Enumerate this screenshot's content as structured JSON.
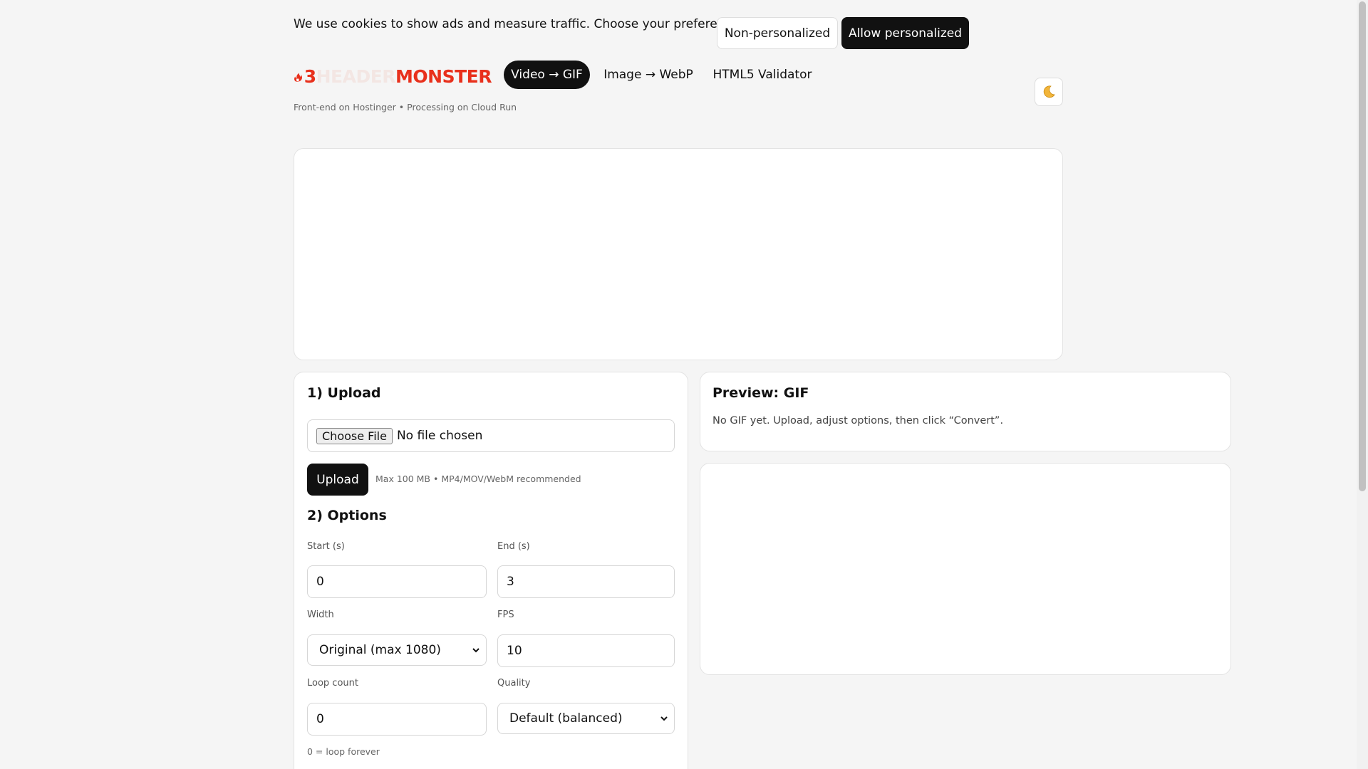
{
  "consent": {
    "message": "We use cookies to show ads and measure traffic. Choose your preference.",
    "non_personalized": "Non-personalized",
    "allow_personalized": "Allow personalized"
  },
  "logo": {
    "digit": "3",
    "faint_word": "HEADER",
    "brand_word": "MONSTER"
  },
  "nav": {
    "tabs": [
      {
        "label": "Video → GIF",
        "active": true
      },
      {
        "label": "Image → WebP",
        "active": false
      },
      {
        "label": "HTML5 Validator",
        "active": false
      }
    ]
  },
  "subtitle": "Front-end on Hostinger • Processing on Cloud Run",
  "theme_toggle_icon": "moon-icon",
  "upload": {
    "title": "1) Upload",
    "choose_file": "Choose File",
    "no_file": "No file chosen",
    "button": "Upload",
    "hint": "Max 100 MB • MP4/MOV/WebM recommended"
  },
  "options": {
    "title": "2) Options",
    "start_label": "Start (s)",
    "start_value": "0",
    "end_label": "End (s)",
    "end_value": "3",
    "width_label": "Width",
    "width_value": "Original (max 1080)",
    "fps_label": "FPS",
    "fps_value": "10",
    "loop_label": "Loop count",
    "loop_value": "0",
    "quality_label": "Quality",
    "quality_value": "Default (balanced)",
    "loop_hint": "0 = loop forever"
  },
  "preview": {
    "title": "Preview: GIF",
    "message": "No GIF yet. Upload, adjust options, then click “Convert”."
  },
  "colors": {
    "accent": "#e8301c",
    "dark": "#111111",
    "background": "#f5f5f5"
  }
}
